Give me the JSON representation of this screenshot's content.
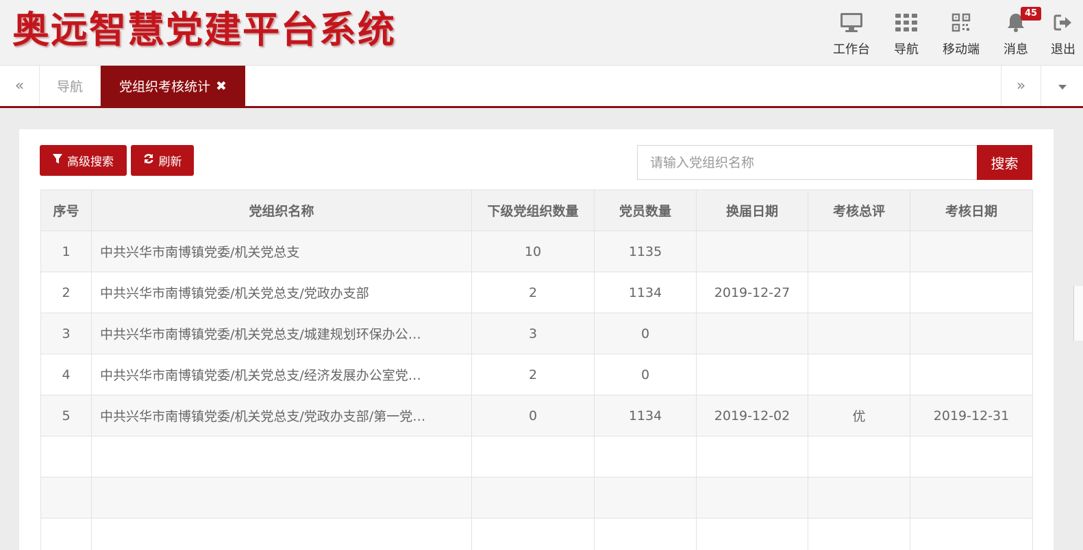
{
  "app": {
    "title": "奥远智慧党建平台系统"
  },
  "topnav": {
    "workbench": "工作台",
    "navigation": "导航",
    "mobile": "移动端",
    "messages": "消息",
    "message_count": "45",
    "logout": "退出"
  },
  "tabs": {
    "left_arrow": "«",
    "right_arrow": "»",
    "nav": "导航",
    "active": "党组织考核统计",
    "close": "✖"
  },
  "toolbar": {
    "advanced_search": "高级搜索",
    "refresh": "刷新",
    "search_placeholder": "请输入党组织名称",
    "search_button": "搜索"
  },
  "table": {
    "headers": [
      "序号",
      "党组织名称",
      "下级党组织数量",
      "党员数量",
      "换届日期",
      "考核总评",
      "考核日期"
    ],
    "rows": [
      [
        "1",
        "中共兴华市南博镇党委/机关党总支",
        "10",
        "1135",
        "",
        "",
        ""
      ],
      [
        "2",
        "中共兴华市南博镇党委/机关党总支/党政办支部",
        "2",
        "1134",
        "2019-12-27",
        "",
        ""
      ],
      [
        "3",
        "中共兴华市南博镇党委/机关党总支/城建规划环保办公…",
        "3",
        "0",
        "",
        "",
        ""
      ],
      [
        "4",
        "中共兴华市南博镇党委/机关党总支/经济发展办公室党…",
        "2",
        "0",
        "",
        "",
        ""
      ],
      [
        "5",
        "中共兴华市南博镇党委/机关党总支/党政办支部/第一党…",
        "0",
        "1134",
        "2019-12-02",
        "优",
        "2019-12-31"
      ],
      [
        "",
        "",
        "",
        "",
        "",
        "",
        ""
      ],
      [
        "",
        "",
        "",
        "",
        "",
        "",
        ""
      ],
      [
        "",
        "",
        "",
        "",
        "",
        "",
        ""
      ]
    ]
  },
  "colors": {
    "brand": "#c3161c",
    "tab_active": "#8c0d10",
    "button": "#b51217"
  }
}
